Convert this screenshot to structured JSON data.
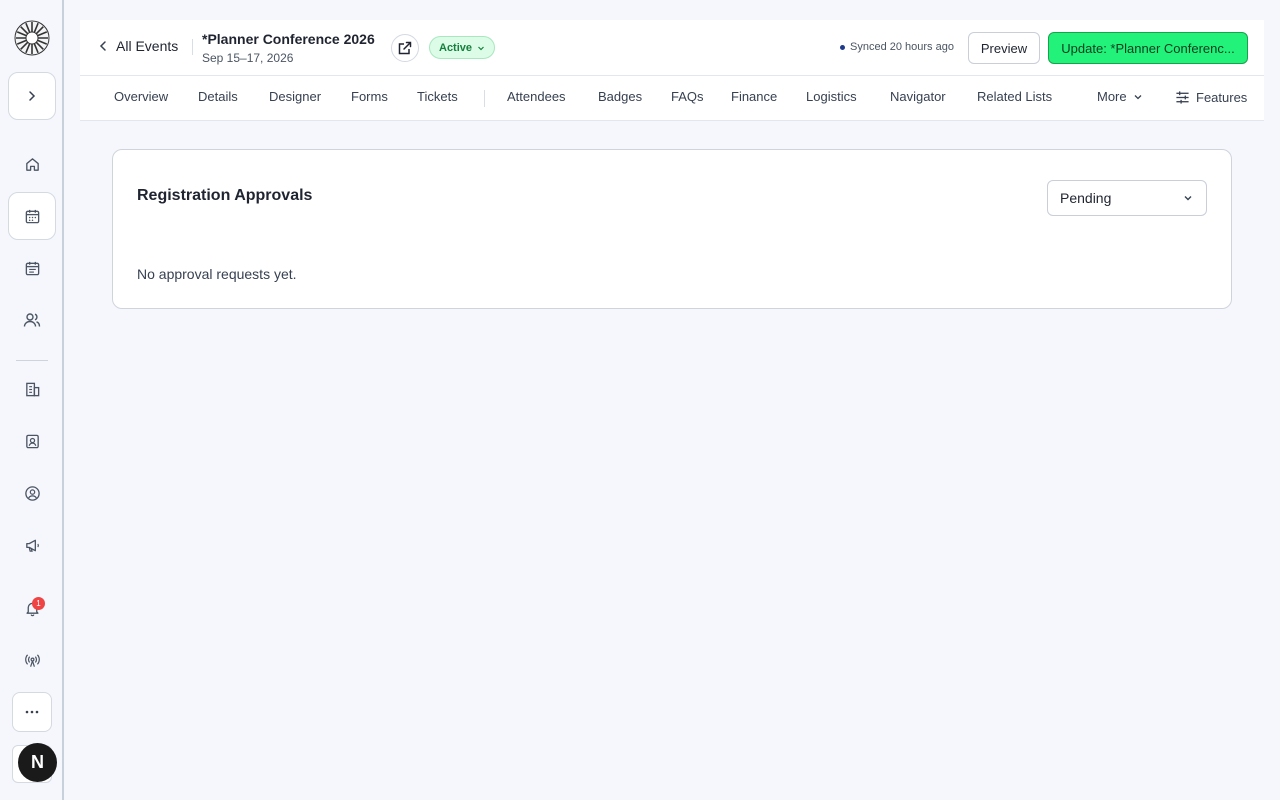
{
  "sidebar": {
    "notification_count": "1",
    "avatar_initial": "N"
  },
  "header": {
    "back_label": "All Events",
    "event_title": "*Planner Conference 2026",
    "event_dates": "Sep 15–17, 2026",
    "status": "Active",
    "synced": "Synced 20 hours ago",
    "preview_label": "Preview",
    "update_label": "Update: *Planner Conferenc..."
  },
  "tabs": [
    "Overview",
    "Details",
    "Designer",
    "Forms",
    "Tickets",
    "Attendees",
    "Badges",
    "FAQs",
    "Finance",
    "Logistics",
    "Navigator",
    "Related Lists"
  ],
  "tabs_more": "More",
  "tabs_features": "Features",
  "card": {
    "title": "Registration Approvals",
    "filter_value": "Pending",
    "empty_message": "No approval requests yet."
  },
  "colors": {
    "accent_green": "#22f27a",
    "status_green": "#dcfce7",
    "notification_red": "#ef4444"
  }
}
